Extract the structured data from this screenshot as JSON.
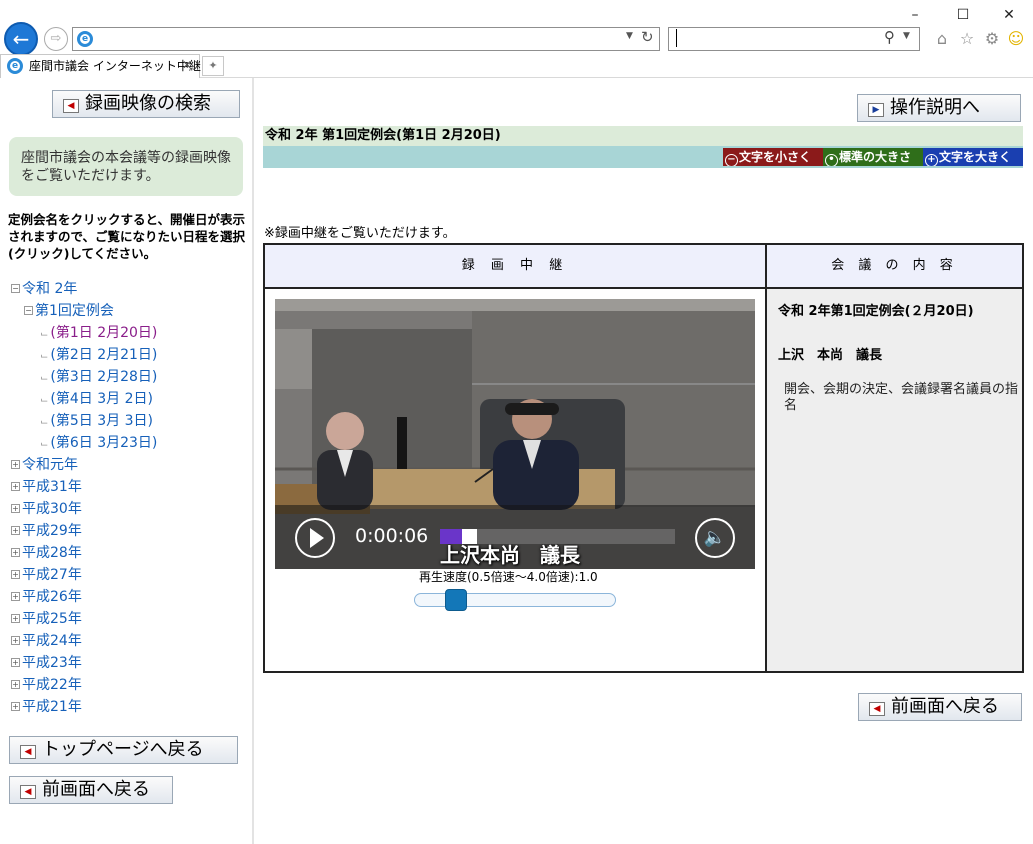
{
  "browser": {
    "tab_title": "座間市議会 インターネット中継",
    "address_value": "",
    "search_value": ""
  },
  "left": {
    "search_button": "録画映像の検索",
    "intro": "座間市議会の本会議等の録画映像をご覧いただけます。",
    "instructions": "定例会名をクリックすると、開催日が表示されますので、ご覧になりたい日程を選択(クリック)してください。",
    "tree": {
      "year_current": "令和 2年",
      "session": "第1回定例会",
      "days": [
        "(第1日 2月20日)",
        "(第2日 2月21日)",
        "(第3日 2月28日)",
        "(第4日 3月 2日)",
        "(第5日 3月 3日)",
        "(第6日 3月23日)"
      ],
      "years": [
        "令和元年",
        "平成31年",
        "平成30年",
        "平成29年",
        "平成28年",
        "平成27年",
        "平成26年",
        "平成25年",
        "平成24年",
        "平成23年",
        "平成22年",
        "平成21年"
      ]
    },
    "top_button": "トップページへ戻る",
    "back_button": "前画面へ戻る"
  },
  "right": {
    "help_button": "操作説明へ",
    "meeting_info": "令和 2年 第1回定例会(第1日 2月20日)",
    "font_small": "文字を小さく",
    "font_standard": "標準の大きさ",
    "font_large": "文字を大きく",
    "note": "※録画中継をご覧いただけます。",
    "header_video": "録 画 中 継",
    "header_content": "会 議 の 内 容",
    "content_meeting": "令和 2年第1回定例会(２月20日)",
    "content_speaker": "上沢　本尚　議長",
    "content_summary": "開会、会期の決定、会議録署名議員の指名",
    "video": {
      "timecode": "0:00:06",
      "caption": "上沢本尚　議長",
      "seek_progress": 0.05
    },
    "speed_label": "再生速度(0.5倍速～4.0倍速):1.0",
    "speed_value": 1.0,
    "back_button": "前画面へ戻る"
  },
  "colors": {
    "green_bar": "#dcebd9",
    "teal_bar": "#a8d5d6",
    "font_small_bg": "#8b1a1a",
    "font_standard_bg": "#2f6e1a",
    "font_large_bg": "#1a3fb0",
    "table_header_bg": "#eef0fc",
    "link": "#1660b9"
  }
}
